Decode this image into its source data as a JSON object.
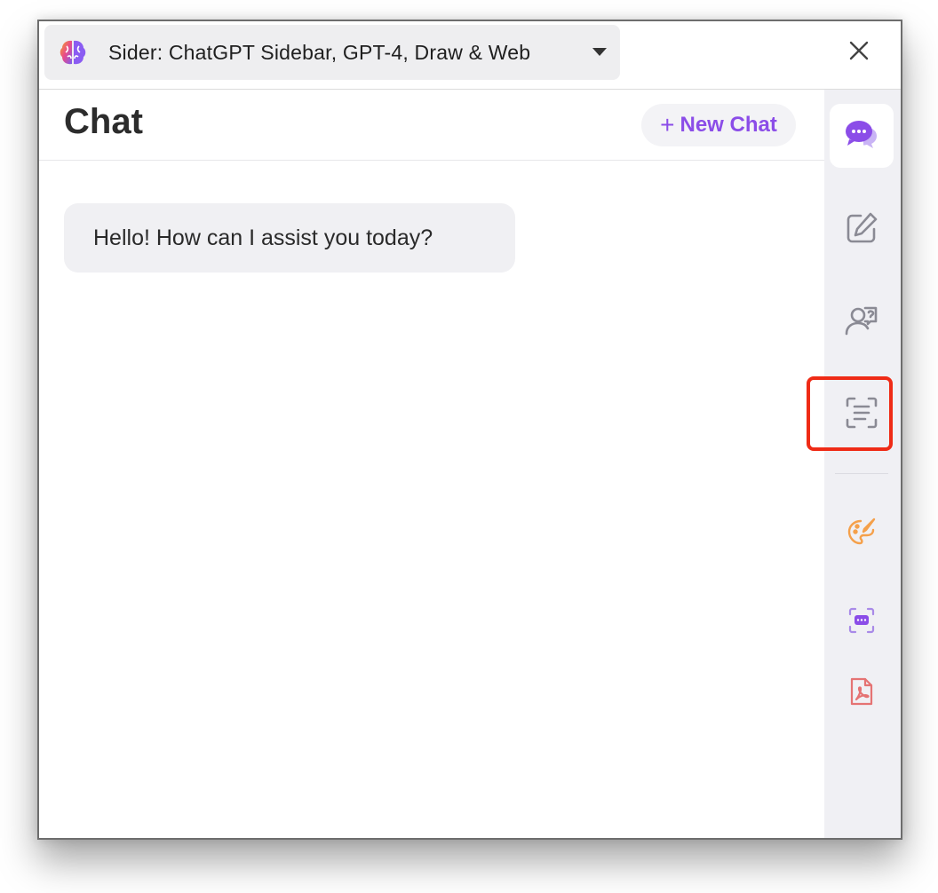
{
  "titlebar": {
    "extension_name": "Sider: ChatGPT Sidebar, GPT-4, Draw & Web",
    "logo_icon": "brain-icon",
    "dropdown_icon": "caret-down-icon",
    "close_icon": "close-icon"
  },
  "chat": {
    "title": "Chat",
    "new_chat_plus": "+",
    "new_chat_label": "New Chat",
    "messages": [
      {
        "role": "assistant",
        "text": "Hello! How can I assist you today?"
      }
    ]
  },
  "rail": {
    "items": [
      {
        "name": "chat",
        "icon": "chat-bubble-icon",
        "active": true
      },
      {
        "name": "write",
        "icon": "edit-icon",
        "active": false
      },
      {
        "name": "contacts",
        "icon": "user-question-icon",
        "active": false
      },
      {
        "name": "ocr",
        "icon": "scan-text-icon",
        "active": false,
        "highlighted": true
      },
      {
        "name": "draw",
        "icon": "paint-palette-icon",
        "active": false
      },
      {
        "name": "screen-chat",
        "icon": "scan-chat-icon",
        "active": false
      },
      {
        "name": "pdf",
        "icon": "pdf-icon",
        "active": false
      }
    ]
  },
  "colors": {
    "accent": "#8b4de8",
    "highlight": "#ef2b16",
    "rail_bg": "#f0f0f4",
    "bubble_bg": "#f0f0f3"
  }
}
